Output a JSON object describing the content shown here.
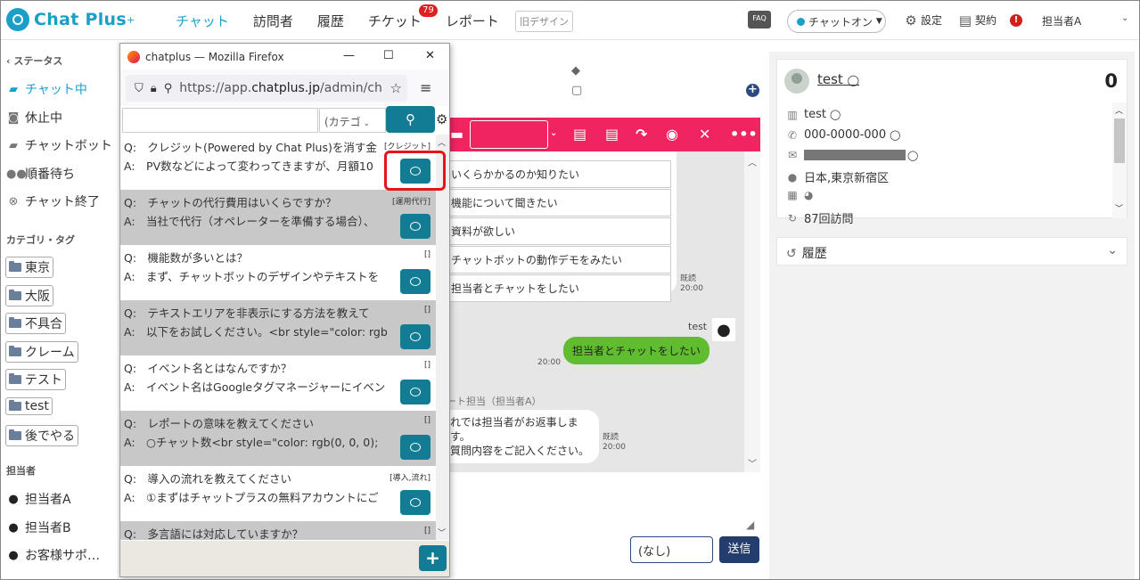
{
  "header": {
    "logo_text": "Chat Plus",
    "logo_sup": "+",
    "nav": [
      {
        "label": "チャット",
        "active": true
      },
      {
        "label": "訪問者",
        "active": false
      },
      {
        "label": "履歴",
        "active": false
      },
      {
        "label": "チケット",
        "active": false,
        "badge": "79"
      },
      {
        "label": "レポート",
        "active": false
      }
    ],
    "old_design": "旧デザイン",
    "faq": "FAQ",
    "chat_on": "チャットオン",
    "settings": "設定",
    "contract": "契約",
    "alert": "!",
    "user": "担当者A"
  },
  "sidebar": {
    "status_title": "ステータス",
    "status_items": [
      {
        "label": "チャット中",
        "icon": "chat-icon",
        "active": true
      },
      {
        "label": "休止中",
        "icon": "pause-icon"
      },
      {
        "label": "チャットボット",
        "icon": "bot-icon"
      },
      {
        "label": "順番待ち",
        "icon": "queue-icon"
      },
      {
        "label": "チャット終了",
        "icon": "end-icon"
      }
    ],
    "category_title": "カテゴリ・タグ",
    "tags": [
      "東京",
      "大阪",
      "不具合",
      "クレーム",
      "テスト",
      "test",
      "後でやる"
    ],
    "staff_title": "担当者",
    "staff": [
      "担当者A",
      "担当者B",
      "お客様サポ…"
    ]
  },
  "firefox": {
    "title": "chatplus — Mozilla Firefox",
    "url_prefix": "https://app.",
    "url_domain": "chatplus.jp",
    "url_suffix": "/admin/ch",
    "category_placeholder": "(カテゴ",
    "faqs": [
      {
        "q": "Q:　クレジット(Powered by Chat Plus)を消す金",
        "a": "A:　PV数などによって変わってきますが、月額10",
        "tag": "[クレジット]",
        "shade": false
      },
      {
        "q": "Q:　チャットの代行費用はいくらですか？",
        "a": "A:　当社で代行（オペレーターを準備する場合）、",
        "tag": "[運用代行]",
        "shade": true
      },
      {
        "q": "Q:　機能数が多いとは？",
        "a": "A:　まず、チャットボットのデザインやテキストを",
        "tag": "[]",
        "shade": false
      },
      {
        "q": "Q:　テキストエリアを非表示にする方法を教えて",
        "a": "A:　以下をお試しください。<br style=\"color: rgb",
        "tag": "[]",
        "shade": true
      },
      {
        "q": "Q:　イベント名とはなんですか？",
        "a": "A:　イベント名はGoogleタグマネージャーにイベン",
        "tag": "[]",
        "shade": false
      },
      {
        "q": "Q:　レポートの意味を教えてください",
        "a": "A:　○チャット数<br style=\"color: rgb(0, 0, 0);",
        "tag": "[]",
        "shade": true
      },
      {
        "q": "Q:　導入の流れを教えてください",
        "a": "A:　①まずはチャットプラスの無料アカウントにご",
        "tag": "[導入,流れ]",
        "shade": false
      },
      {
        "q": "Q:　多言語には対応していますか？",
        "a": "",
        "tag": "[]",
        "shade": true
      }
    ]
  },
  "chat": {
    "options": [
      "いくらかかるのか知りたい",
      "機能について聞きたい",
      "資料が欲しい",
      "チャットボットの動作デモをみたい",
      "担当者とチャットをしたい"
    ],
    "read_label": "既読",
    "time": "20:00",
    "visitor_name": "test",
    "visitor_message": "担当者とチャットをしたい",
    "agent_label": "ート担当（担当者A）",
    "agent_message_1": "れでは担当者がお返事します。",
    "agent_message_2": "質問内容をご記入ください。",
    "select_value": "(なし)",
    "send": "送信"
  },
  "visitor": {
    "name": "test",
    "count": "0",
    "company": "test",
    "phone": "000-0000-000",
    "location": "日本,東京新宿区",
    "visits": "87回訪問",
    "history_title": "履歴"
  }
}
